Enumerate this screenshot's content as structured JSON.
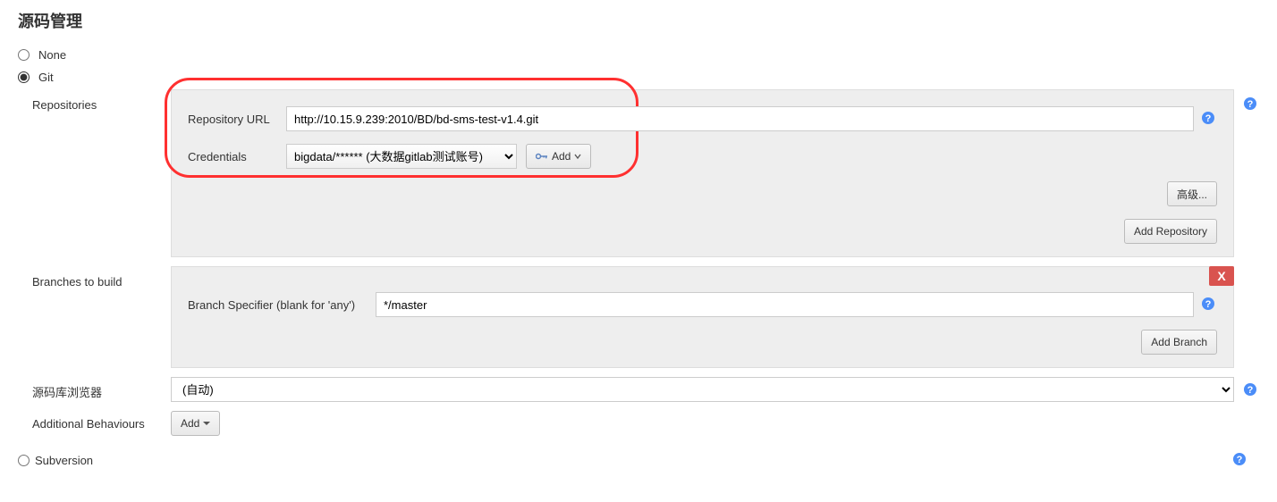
{
  "section": {
    "title": "源码管理"
  },
  "scm_options": {
    "none_label": "None",
    "git_label": "Git",
    "subversion_label": "Subversion",
    "selected": "git"
  },
  "repositories": {
    "label": "Repositories",
    "repo_url_label": "Repository URL",
    "repo_url_value": "http://10.15.9.239:2010/BD/bd-sms-test-v1.4.git",
    "credentials_label": "Credentials",
    "credentials_value": "bigdata/****** (大数据gitlab测试账号)",
    "add_button": "Add",
    "advanced_button": "高级...",
    "add_repo_button": "Add Repository"
  },
  "branches": {
    "label": "Branches to build",
    "specifier_label": "Branch Specifier (blank for 'any')",
    "specifier_value": "*/master",
    "add_branch_button": "Add Branch",
    "delete_label": "X"
  },
  "browser": {
    "label": "源码库浏览器",
    "value": "(自动)"
  },
  "additional": {
    "label": "Additional Behaviours",
    "add_button": "Add"
  }
}
